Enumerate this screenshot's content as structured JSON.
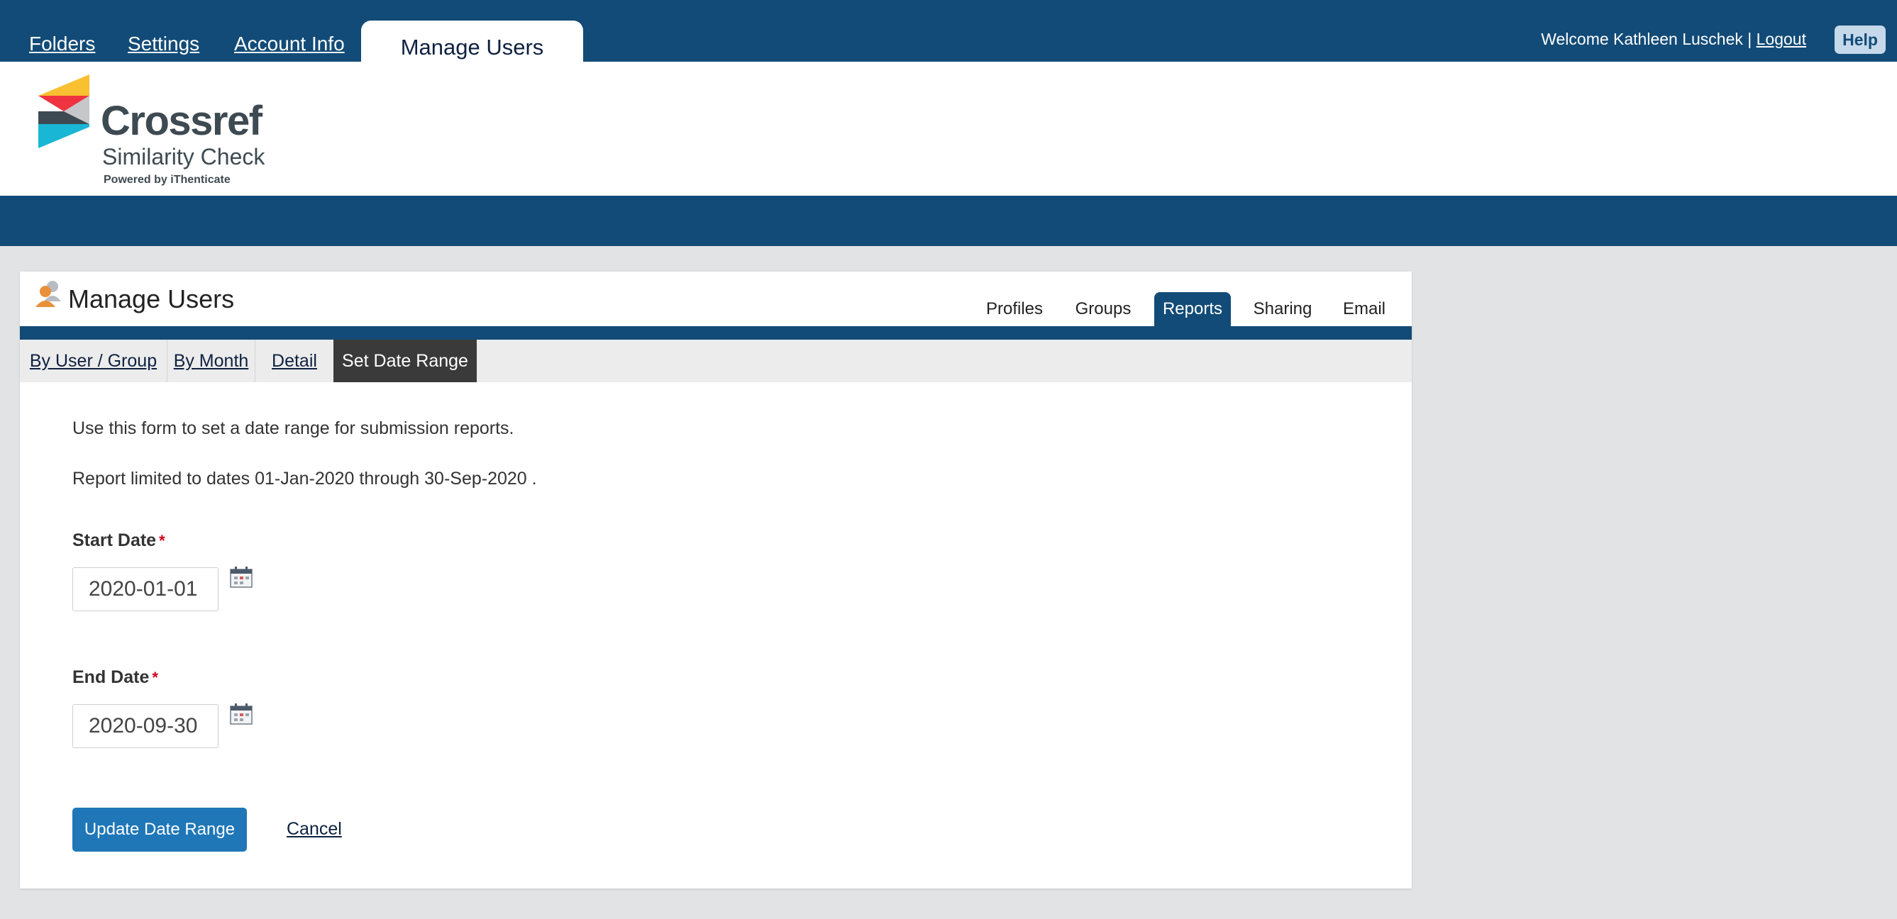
{
  "topnav": {
    "folders": "Folders",
    "settings": "Settings",
    "account_info": "Account Info",
    "manage_users": "Manage Users"
  },
  "user": {
    "welcome": "Welcome Kathleen Luschek |",
    "logout": "Logout",
    "help": "Help"
  },
  "logo": {
    "name": "Crossref",
    "subtitle": "Similarity Check",
    "powered_by": "Powered by iThenticate"
  },
  "panel": {
    "title": "Manage Users",
    "tabs": [
      "Profiles",
      "Groups",
      "Reports",
      "Sharing",
      "Email"
    ],
    "active_tab": "Reports"
  },
  "subnav": {
    "tabs": [
      "By User / Group",
      "By Month",
      "Detail",
      "Set Date Range"
    ],
    "active_tab": "Set Date Range"
  },
  "form": {
    "intro": "Use this form to set a date range for submission reports.",
    "limit_text": "Report limited to dates 01-Jan-2020 through 30-Sep-2020 .",
    "start_label": "Start Date",
    "start_value": "2020-01-01",
    "end_label": "End Date",
    "end_value": "2020-09-30",
    "required_mark": "*",
    "update_button": "Update Date Range",
    "cancel_link": "Cancel"
  },
  "colors": {
    "header_blue": "#124b77",
    "button_blue": "#1f77b7",
    "active_subtab": "#3a3a3a",
    "required_red": "#d0021b"
  }
}
